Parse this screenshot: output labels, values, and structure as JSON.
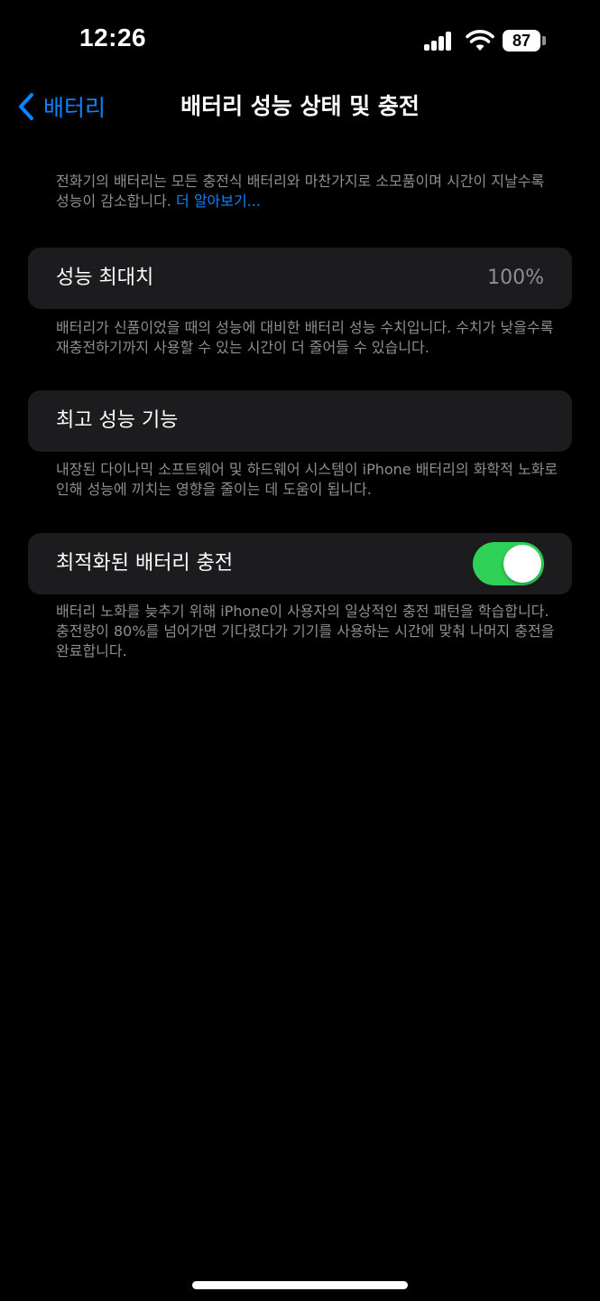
{
  "status_bar": {
    "time": "12:26",
    "battery_level": "87",
    "icons": [
      "signal-icon",
      "wifi-icon",
      "battery-icon"
    ]
  },
  "nav": {
    "back_label": "배터리",
    "title": "배터리 성능 상태 및 충전"
  },
  "intro": {
    "text": "전화기의 배터리는 모든 충전식 배터리와 마찬가지로 소모품이며 시간이 지날수록 성능이 감소합니다.",
    "link": "더 알아보기..."
  },
  "maximum_capacity": {
    "label": "성능 최대치",
    "value": "100%",
    "footnote": "배터리가 신품이었을 때의 성능에 대비한 배터리 성능 수치입니다. 수치가 낮을수록 재충전하기까지 사용할 수 있는 시간이 더 줄어들 수 있습니다."
  },
  "peak_performance": {
    "label": "최고 성능 기능",
    "footnote": "내장된 다이나믹 소프트웨어 및 하드웨어 시스템이 iPhone 배터리의 화학적 노화로 인해 성능에 끼치는 영향을 줄이는 데 도움이 됩니다."
  },
  "optimized_charging": {
    "label": "최적화된 배터리 충전",
    "enabled": true,
    "footnote": "배터리 노화를 늦추기 위해 iPhone이 사용자의 일상적인 충전 패턴을 학습합니다. 충전량이 80%를 넘어가면 기다렸다가 기기를 사용하는 시간에 맞춰 나머지 충전을 완료합니다."
  },
  "colors": {
    "accent": "#0a84ff",
    "toggle_on": "#30d158",
    "card_bg": "#1c1c1e",
    "secondary_text": "#8e8e93"
  }
}
